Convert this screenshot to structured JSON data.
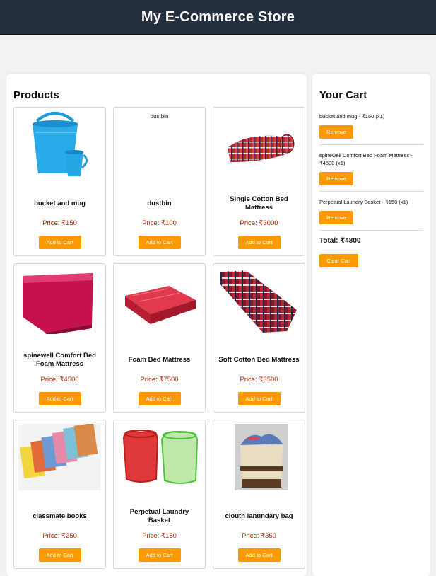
{
  "header": {
    "title": "My E-Commerce Store"
  },
  "products": {
    "heading": "Products",
    "add_label": "Add to Cart",
    "items": [
      {
        "name": "bucket and mug",
        "price": "Price: ₹150",
        "image": "bucket-mug-image",
        "alt": ""
      },
      {
        "name": "dustbin",
        "price": "Price: ₹100",
        "image": "broken-image",
        "alt": "dustbin"
      },
      {
        "name": "Single Cotton Bed Mattress",
        "price": "Price: ₹3000",
        "image": "rolled-mattress-image",
        "alt": ""
      },
      {
        "name": "spinewell Comfort Bed Foam Mattress",
        "price": "Price: ₹4500",
        "image": "pink-mattress-image",
        "alt": ""
      },
      {
        "name": "Foam Bed Mattress",
        "price": "Price: ₹7500",
        "image": "red-foam-mattress-image",
        "alt": ""
      },
      {
        "name": "Soft Cotton Bed Mattress",
        "price": "Price: ₹3500",
        "image": "checked-mattress-image",
        "alt": ""
      },
      {
        "name": "classmate books",
        "price": "Price: ₹250",
        "image": "notebooks-image",
        "alt": ""
      },
      {
        "name": "Perpetual Laundry Basket",
        "price": "Price: ₹150",
        "image": "laundry-basket-image",
        "alt": ""
      },
      {
        "name": "clouth lanundary bag",
        "price": "Price: ₹350",
        "image": "laundry-bag-image",
        "alt": ""
      }
    ]
  },
  "cart": {
    "heading": "Your Cart",
    "remove_label": "Remove",
    "items": [
      {
        "line": "bucket and mug - ₹150 (x1)"
      },
      {
        "line": "spinewell Comfort Bed Foam Mattress - ₹4500 (x1)"
      },
      {
        "line": "Perpetual Laundry Basket - ₹150 (x1)"
      }
    ],
    "total": "Total: ₹4800",
    "clear_label": "Clear Cart"
  },
  "colors": {
    "header_bg": "#232f3e",
    "accent": "#ff9900",
    "price": "#b02a05"
  }
}
